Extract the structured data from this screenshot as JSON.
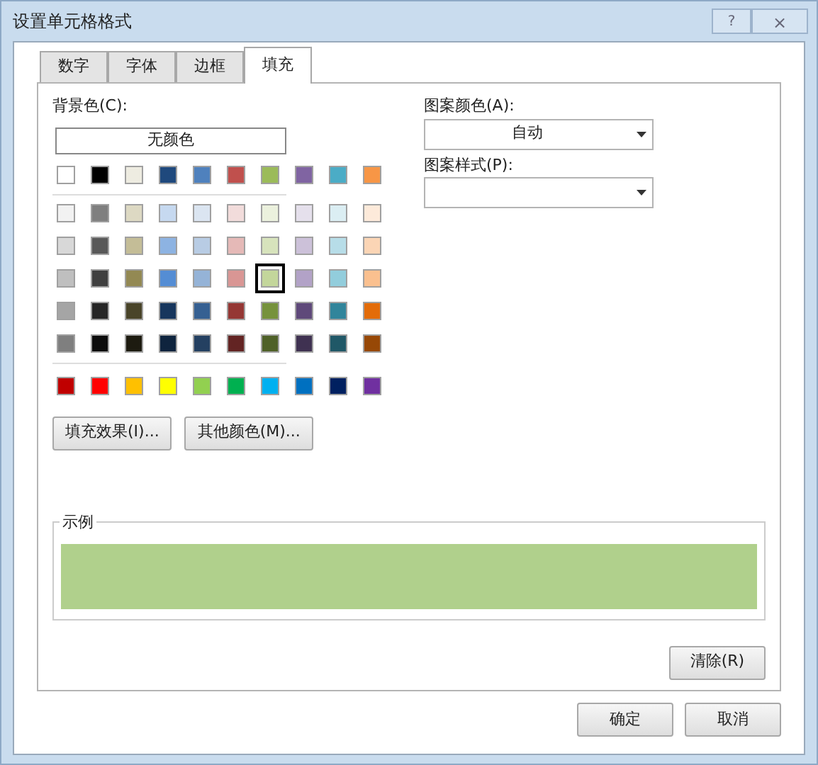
{
  "window": {
    "title": "设置单元格格式",
    "help": "?",
    "close": "×"
  },
  "tabs": [
    {
      "label": "数字",
      "selected": false
    },
    {
      "label": "字体",
      "selected": false
    },
    {
      "label": "边框",
      "selected": false
    },
    {
      "label": "填充",
      "selected": true
    }
  ],
  "background": {
    "label": "背景色(C):",
    "no_color_button": "无颜色",
    "theme": [
      {
        "color": "#ffffff",
        "selected": false
      },
      {
        "color": "#000000",
        "selected": false
      },
      {
        "color": "#eeece1",
        "selected": false
      },
      {
        "color": "#1f497d",
        "selected": false
      },
      {
        "color": "#4f81bd",
        "selected": false
      },
      {
        "color": "#c0504d",
        "selected": false
      },
      {
        "color": "#9bbb59",
        "selected": false
      },
      {
        "color": "#8064a2",
        "selected": false
      },
      {
        "color": "#4bacc6",
        "selected": false
      },
      {
        "color": "#f79646",
        "selected": false
      }
    ],
    "tints": [
      [
        {
          "color": "#f2f2f2",
          "selected": false
        },
        {
          "color": "#7f7f7f",
          "selected": false
        },
        {
          "color": "#ddd9c3",
          "selected": false
        },
        {
          "color": "#c6d9f0",
          "selected": false
        },
        {
          "color": "#dbe5f1",
          "selected": false
        },
        {
          "color": "#f2dcdb",
          "selected": false
        },
        {
          "color": "#ebf1dd",
          "selected": false
        },
        {
          "color": "#e5e0ec",
          "selected": false
        },
        {
          "color": "#dbeef3",
          "selected": false
        },
        {
          "color": "#fdeada",
          "selected": false
        }
      ],
      [
        {
          "color": "#d8d8d8",
          "selected": false
        },
        {
          "color": "#595959",
          "selected": false
        },
        {
          "color": "#c4bd97",
          "selected": false
        },
        {
          "color": "#8db3e2",
          "selected": false
        },
        {
          "color": "#b8cce4",
          "selected": false
        },
        {
          "color": "#e5b9b7",
          "selected": false
        },
        {
          "color": "#d7e3bc",
          "selected": false
        },
        {
          "color": "#ccc1d9",
          "selected": false
        },
        {
          "color": "#b7dde8",
          "selected": false
        },
        {
          "color": "#fbd5b5",
          "selected": false
        }
      ],
      [
        {
          "color": "#bfbfbf",
          "selected": false
        },
        {
          "color": "#3f3f3f",
          "selected": false
        },
        {
          "color": "#938953",
          "selected": false
        },
        {
          "color": "#548dd4",
          "selected": false
        },
        {
          "color": "#95b3d7",
          "selected": false
        },
        {
          "color": "#d99694",
          "selected": false
        },
        {
          "color": "#c3d69b",
          "selected": true
        },
        {
          "color": "#b2a2c7",
          "selected": false
        },
        {
          "color": "#92cddc",
          "selected": false
        },
        {
          "color": "#fac08f",
          "selected": false
        }
      ],
      [
        {
          "color": "#a5a5a5",
          "selected": false
        },
        {
          "color": "#262626",
          "selected": false
        },
        {
          "color": "#494429",
          "selected": false
        },
        {
          "color": "#17365d",
          "selected": false
        },
        {
          "color": "#366092",
          "selected": false
        },
        {
          "color": "#953734",
          "selected": false
        },
        {
          "color": "#76923c",
          "selected": false
        },
        {
          "color": "#5f497a",
          "selected": false
        },
        {
          "color": "#31859b",
          "selected": false
        },
        {
          "color": "#e36c09",
          "selected": false
        }
      ],
      [
        {
          "color": "#7f7f7f",
          "selected": false
        },
        {
          "color": "#0c0c0c",
          "selected": false
        },
        {
          "color": "#1d1b10",
          "selected": false
        },
        {
          "color": "#0f243e",
          "selected": false
        },
        {
          "color": "#244061",
          "selected": false
        },
        {
          "color": "#632423",
          "selected": false
        },
        {
          "color": "#4f6128",
          "selected": false
        },
        {
          "color": "#3f3151",
          "selected": false
        },
        {
          "color": "#205867",
          "selected": false
        },
        {
          "color": "#974806",
          "selected": false
        }
      ]
    ],
    "standard": [
      {
        "color": "#c00000",
        "selected": false
      },
      {
        "color": "#ff0000",
        "selected": false
      },
      {
        "color": "#ffc000",
        "selected": false
      },
      {
        "color": "#ffff00",
        "selected": false
      },
      {
        "color": "#92d050",
        "selected": false
      },
      {
        "color": "#00b050",
        "selected": false
      },
      {
        "color": "#00b0f0",
        "selected": false
      },
      {
        "color": "#0070c0",
        "selected": false
      },
      {
        "color": "#002060",
        "selected": false
      },
      {
        "color": "#7030a0",
        "selected": false
      }
    ],
    "buttons": [
      "填充效果(I)...",
      "其他颜色(M)..."
    ]
  },
  "pattern": {
    "color_label": "图案颜色(A):",
    "color_value": "自动",
    "style_label": "图案样式(P):"
  },
  "sample": {
    "label": "示例",
    "color": "#b0d08c"
  },
  "clear_button": "清除(R)",
  "buttons": [
    "确定",
    "取消"
  ]
}
